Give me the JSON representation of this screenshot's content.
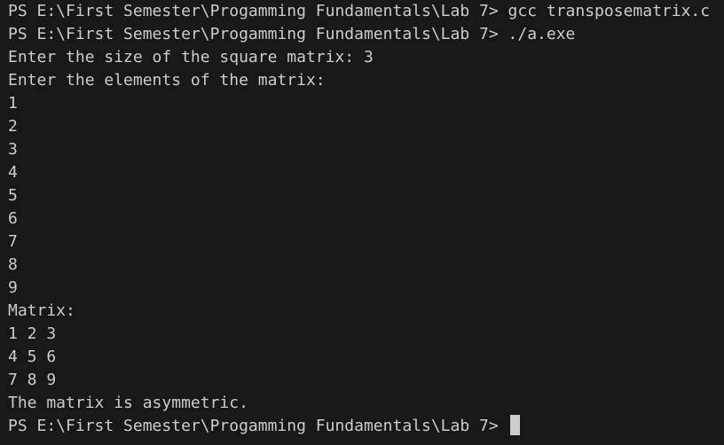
{
  "terminal": {
    "lines": [
      "PS E:\\First Semester\\Progamming Fundamentals\\Lab 7> gcc transposematrix.c",
      "PS E:\\First Semester\\Progamming Fundamentals\\Lab 7> ./a.exe",
      "Enter the size of the square matrix: 3",
      "Enter the elements of the matrix:",
      "1",
      "2",
      "3",
      "4",
      "5",
      "6",
      "7",
      "8",
      "9",
      "Matrix:",
      "1 2 3",
      "4 5 6",
      "7 8 9",
      "The matrix is asymmetric.",
      "PS E:\\First Semester\\Progamming Fundamentals\\Lab 7> "
    ]
  },
  "colors": {
    "background": "#181818",
    "foreground": "#cccccc",
    "cursor": "#cccccc"
  }
}
